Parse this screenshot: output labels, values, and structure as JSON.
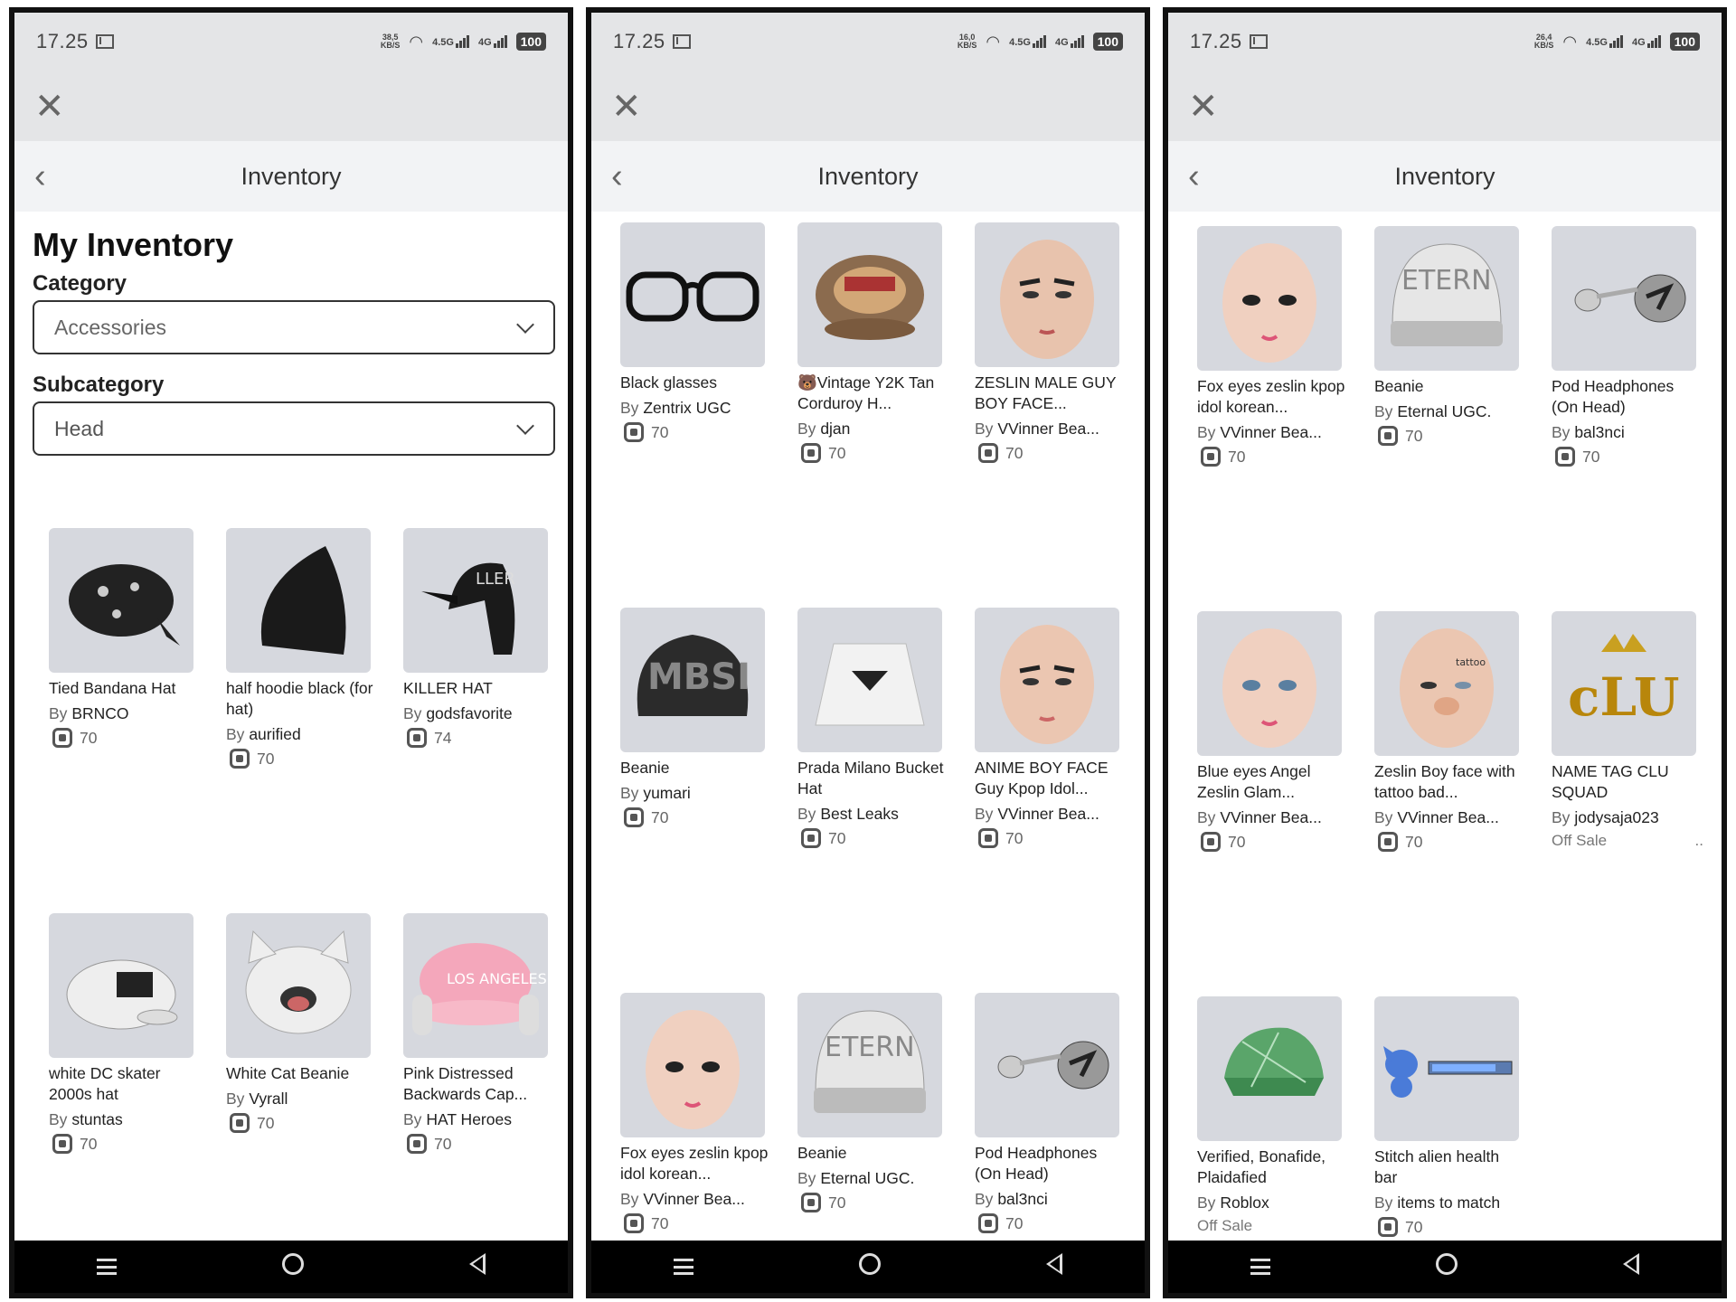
{
  "status": {
    "time": "17.25",
    "battery": "100",
    "sig1": "4.5G",
    "sig2": "4G"
  },
  "screens": [
    {
      "speed": [
        "38,5",
        "KB/S"
      ],
      "title": "Inventory",
      "heading": "My Inventory",
      "category_label": "Category",
      "category_value": "Accessories",
      "subcategory_label": "Subcategory",
      "subcategory_value": "Head",
      "items": [
        {
          "name": "Tied Bandana Hat",
          "by": "By",
          "creator": "BRNCO",
          "price": "70"
        },
        {
          "name": "half hoodie black (for hat)",
          "by": "By",
          "creator": "aurified",
          "price": "70"
        },
        {
          "name": "KILLER HAT",
          "by": "By",
          "creator": "godsfavorite",
          "price": "74"
        },
        {
          "name": "white DC skater 2000s hat",
          "by": "By",
          "creator": "stuntas",
          "price": "70"
        },
        {
          "name": "White Cat Beanie",
          "by": "By",
          "creator": "Vyrall",
          "price": "70"
        },
        {
          "name": "Pink Distressed Backwards Cap...",
          "by": "By",
          "creator": "HAT Heroes",
          "price": "70"
        }
      ]
    },
    {
      "speed": [
        "16,0",
        "KB/S"
      ],
      "title": "Inventory",
      "items": [
        {
          "name": "Black glasses",
          "by": "By",
          "creator": "Zentrix UGC",
          "price": "70"
        },
        {
          "name": "🐻Vintage Y2K Tan Corduroy H...",
          "by": "By",
          "creator": "djan",
          "price": "70"
        },
        {
          "name": "ZESLIN MALE GUY BOY FACE...",
          "by": "By",
          "creator": "VVinner Bea...",
          "price": "70"
        },
        {
          "name": "Beanie",
          "by": "By",
          "creator": "yumari",
          "price": "70"
        },
        {
          "name": "Prada Milano Bucket Hat",
          "by": "By",
          "creator": "Best Leaks",
          "price": "70"
        },
        {
          "name": "ANIME BOY FACE Guy Kpop Idol...",
          "by": "By",
          "creator": "VVinner Bea...",
          "price": "70"
        },
        {
          "name": "Fox eyes zeslin kpop idol korean...",
          "by": "By",
          "creator": "VVinner Bea...",
          "price": "70"
        },
        {
          "name": "Beanie",
          "by": "By",
          "creator": "Eternal UGC.",
          "price": "70"
        },
        {
          "name": "Pod Headphones (On Head)",
          "by": "By",
          "creator": "bal3nci",
          "price": "70"
        }
      ]
    },
    {
      "speed": [
        "26,4",
        "KB/S"
      ],
      "title": "Inventory",
      "items": [
        {
          "name": "Fox eyes zeslin kpop idol korean...",
          "by": "By",
          "creator": "VVinner Bea...",
          "price": "70"
        },
        {
          "name": "Beanie",
          "by": "By",
          "creator": "Eternal UGC.",
          "price": "70"
        },
        {
          "name": "Pod Headphones (On Head)",
          "by": "By",
          "creator": "bal3nci",
          "price": "70"
        },
        {
          "name": "Blue eyes Angel Zeslin Glam...",
          "by": "By",
          "creator": "VVinner Bea...",
          "price": "70"
        },
        {
          "name": "Zeslin Boy face with tattoo bad...",
          "by": "By",
          "creator": "VVinner Bea...",
          "price": "70"
        },
        {
          "name": "NAME TAG CLU SQUAD",
          "by": "By",
          "creator": "jodysaja023",
          "offsale": "Off Sale",
          "dots": ".."
        },
        {
          "name": "Verified, Bonafide, Plaidafied",
          "by": "By",
          "creator": "Roblox",
          "offsale": "Off Sale"
        },
        {
          "name": "Stitch alien health bar",
          "by": "By",
          "creator": "items to match",
          "price": "70"
        }
      ]
    }
  ]
}
